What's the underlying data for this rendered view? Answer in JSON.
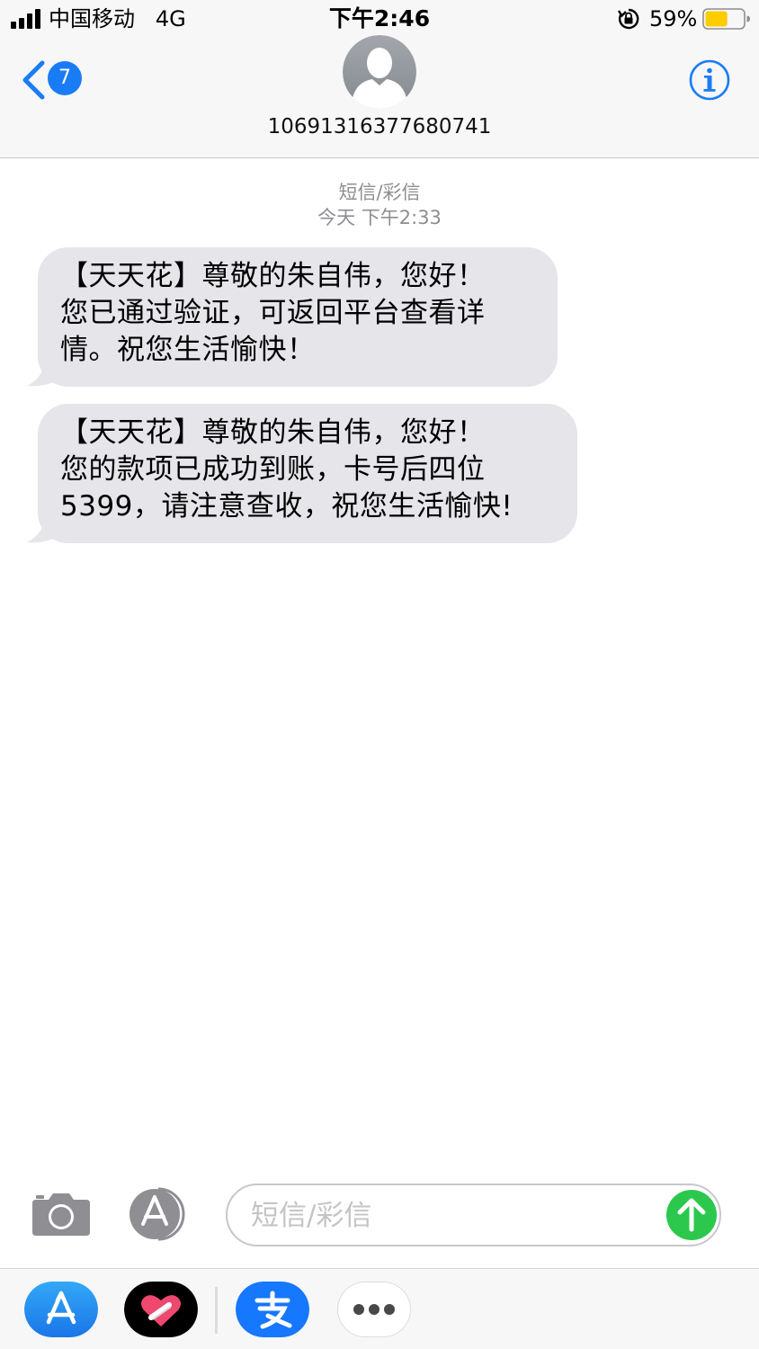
{
  "status_bar": {
    "carrier": "中国移动",
    "network": "4G",
    "time": "下午2:46",
    "battery_percent": "59%",
    "battery_level": 0.59,
    "battery_color": "#ffcc00",
    "icons": [
      "cellular-signal-icon",
      "orientation-lock-icon",
      "battery-icon"
    ]
  },
  "header": {
    "back_badge_count": "7",
    "contact_number": "10691316377680741",
    "accent_color": "#1a7cf5",
    "icons": [
      "back-chevron-icon",
      "contact-avatar-icon",
      "info-icon"
    ]
  },
  "conversation": {
    "service_label": "短信/彩信",
    "timestamp": "今天 下午2:33",
    "bubble_color": "#e5e5ea",
    "messages": [
      {
        "text": "【天天花】尊敬的朱自伟，您好！\n您已通过验证，可返回平台查看详\n情。祝您生活愉快！"
      },
      {
        "text": "【天天花】尊敬的朱自伟，您好！\n您的款项已成功到账，卡号后四位\n5399，请注意查收，祝您生活愉快!"
      }
    ]
  },
  "input_bar": {
    "placeholder": "短信/彩信",
    "send_color": "#2cc84d",
    "icons": [
      "camera-icon",
      "app-store-icon",
      "send-arrow-icon"
    ]
  },
  "app_drawer": {
    "apps": [
      {
        "name": "app-store-icon",
        "color": "#1b8cf2"
      },
      {
        "name": "heart-sticker-icon",
        "color": "#000000"
      },
      {
        "name": "alipay-icon",
        "color": "#1677ff"
      },
      {
        "name": "more-icon",
        "color": "#ffffff"
      }
    ]
  }
}
